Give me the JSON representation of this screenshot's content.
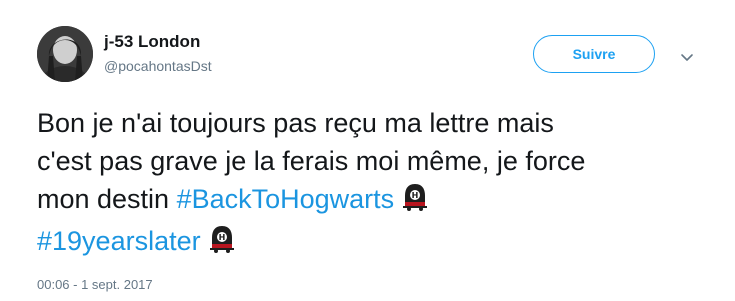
{
  "user": {
    "name": "j-53 London",
    "handle": "@pocahontasDst"
  },
  "follow_button": {
    "label": "Suivre"
  },
  "tweet": {
    "line1": "Bon je n'ai toujours pas reçu ma lettre mais",
    "line2": "c'est pas grave je la ferais moi même, je force",
    "line3_text": "mon destin ",
    "hashtag1": "#BackToHogwarts",
    "hashtag2": "#19yearslater",
    "emoji": "train-emoji"
  },
  "timestamp": "00:06 - 1 sept. 2017",
  "colors": {
    "accent": "#1da1f2",
    "hashtag": "#1b95e0",
    "muted": "#657786",
    "text": "#14171a"
  }
}
